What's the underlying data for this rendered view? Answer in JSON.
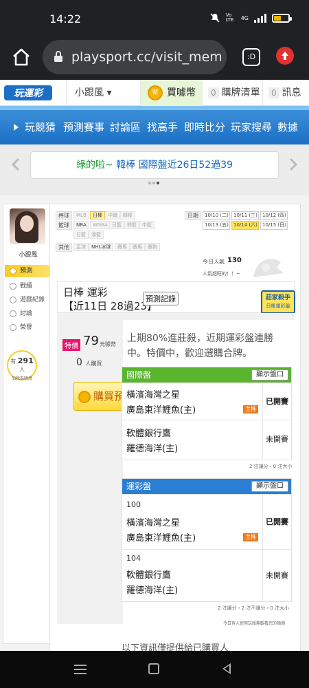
{
  "status_bar": {
    "time": "14:22",
    "net": "4G",
    "volte": "Vo LTE"
  },
  "browser": {
    "url": "playsport.cc/visit_memb",
    "tabs_label": ":D"
  },
  "site_header": {
    "logo_text": "玩運彩",
    "user_menu": "小跟風 ▾",
    "coin_icon": "幣",
    "coin_label": "買噱幣",
    "cart_count": "0",
    "cart_label": "購牌清單",
    "msg_count": "0",
    "msg_label": "訊息"
  },
  "nav": {
    "items": [
      "玩競猜",
      "預測賽事",
      "討論區",
      "找高手",
      "即時比分",
      "玩家搜尋",
      "數據"
    ]
  },
  "ticker": {
    "prefix": "綠的啦~",
    "text": "韓棒 國際盤近26日52過39"
  },
  "sidebar": {
    "name": "小跟風",
    "items": [
      "預測",
      "戰績",
      "遊戲紀錄",
      "討論",
      "榮譽"
    ],
    "fans_prefix": "有",
    "fans_count": "291",
    "fans_unit": "人",
    "fans_suffix": "加我為明燈"
  },
  "filters": {
    "ball_label": "棒球",
    "ball_chips": [
      "MLB",
      "日棒",
      "中職",
      "韓棒"
    ],
    "basket_label": "籃球",
    "basket_chips": [
      "NBA",
      "WNBA",
      "日籃",
      "韓籃",
      "中籃",
      "日籃",
      "澳籃"
    ],
    "other_label": "其他",
    "other_chips": [
      "足球",
      "NHL冰球",
      "賽馬",
      "賽馬",
      "賽狗"
    ],
    "date_label": "日期",
    "dates": [
      "10/10 (二)",
      "10/11 (三)",
      "10/12 (四)",
      "10/13 (五)",
      "10/14 (六)",
      "10/15 (日)"
    ],
    "pop_label": "今日人氣",
    "pop_value": "130",
    "pop_sub": "人氣超旺的！！~"
  },
  "card": {
    "league": "日棒 運彩",
    "record": "【近11日 28過23】",
    "record_btn": "預測記錄",
    "banker_top": "莊家殺手",
    "banker_sub": "日棒運彩盤",
    "tag": "特價",
    "price": "79",
    "price_unit": "元噱幣",
    "buyers": "0",
    "buyers_unit": "人購買",
    "buy_btn": "購買預測",
    "description": "上期80%進莊殺，近期運彩盤連勝中。特價中，歡迎選購合牌。"
  },
  "intl_table": {
    "header": "國際盤",
    "show_btn": "顯示盤口",
    "rows": [
      {
        "team1": "橫濱海灣之星",
        "team2": "廣島東洋鯉魚(主)",
        "badge": "主推",
        "status": "已開賽"
      },
      {
        "team1": "軟體銀行鷹",
        "team2": "羅德海洋(主)",
        "badge": "",
        "status": "未開賽"
      }
    ],
    "footer": "2 注讓分・0 注大小"
  },
  "lottery_table": {
    "header": "運彩盤",
    "show_btn": "顯示盤口",
    "rows": [
      {
        "num": "100",
        "team1": "橫濱海灣之星",
        "team2": "廣島東洋鯉魚(主)",
        "badge": "主推",
        "status": "已開賽"
      },
      {
        "num": "104",
        "team1": "軟體銀行鷹",
        "team2": "羅德海洋(主)",
        "badge": "",
        "status": "未開賽"
      }
    ],
    "footer": "2 注讓分・2 注不讓分・0 注大小"
  },
  "footnote": "今日有人使用玩殺無觀看您的預測",
  "bottom_text": "以下資訊僅提供給已購買人",
  "colors": {
    "nav_blue": "#1b6ec4",
    "green": "#59b42e",
    "blue_header": "#2a7fd4",
    "yellow": "#ffd83a",
    "orange_badge": "#ee7a19"
  }
}
